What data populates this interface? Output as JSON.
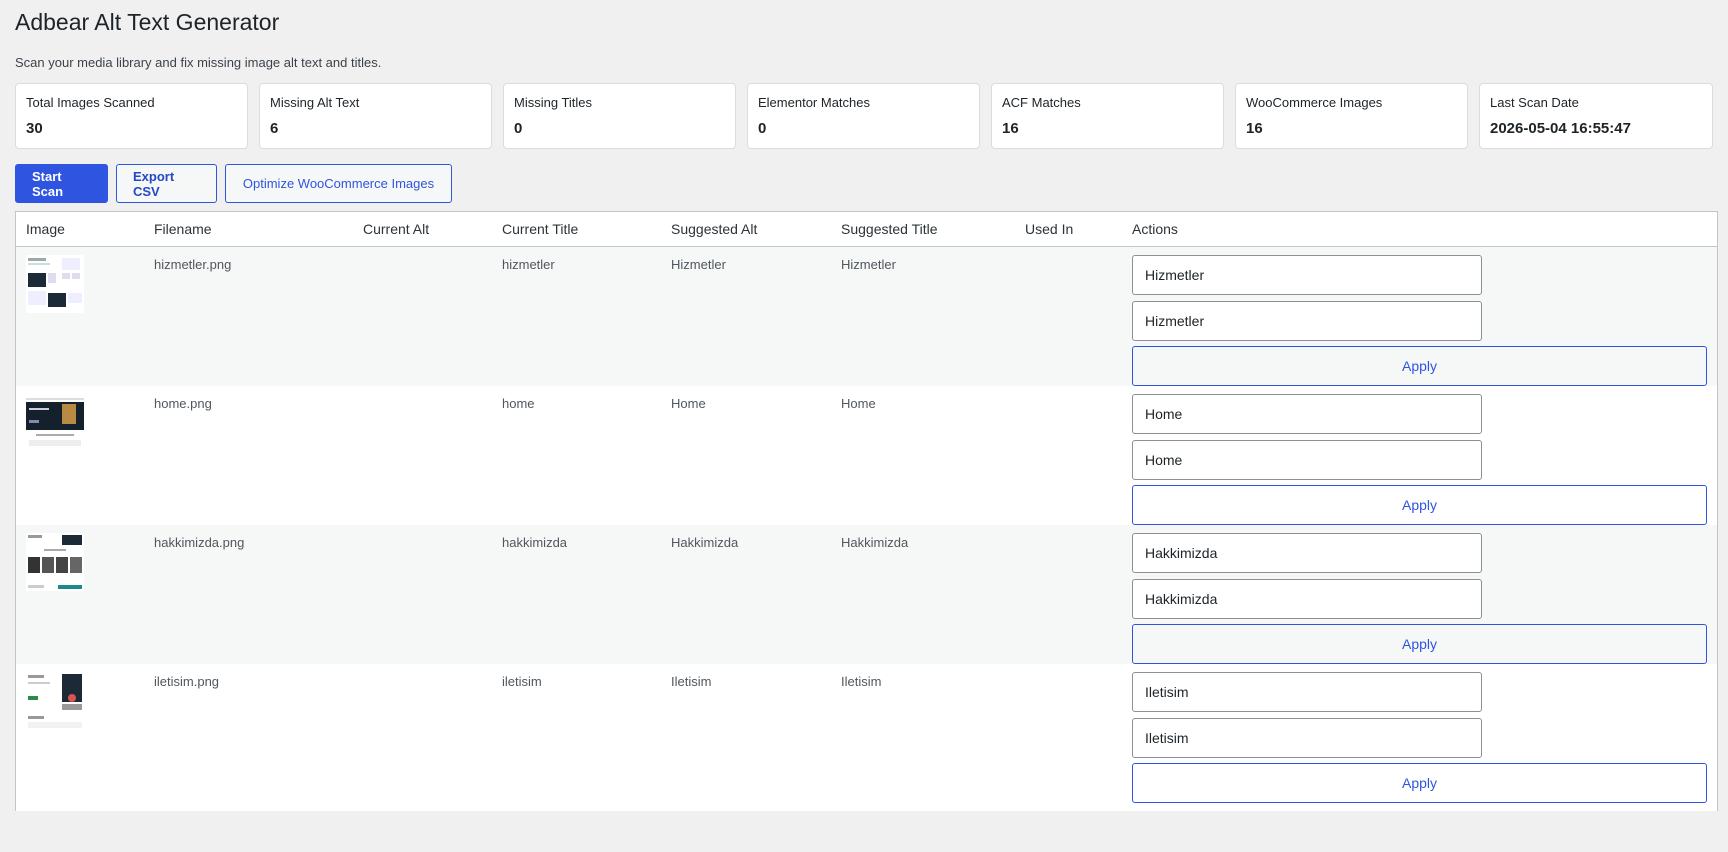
{
  "page": {
    "title": "Adbear Alt Text Generator",
    "subtitle": "Scan your media library and fix missing image alt text and titles."
  },
  "stats": [
    {
      "label": "Total Images Scanned",
      "value": "30"
    },
    {
      "label": "Missing Alt Text",
      "value": "6"
    },
    {
      "label": "Missing Titles",
      "value": "0"
    },
    {
      "label": "Elementor Matches",
      "value": "0"
    },
    {
      "label": "ACF Matches",
      "value": "16"
    },
    {
      "label": "WooCommerce Images",
      "value": "16"
    },
    {
      "label": "Last Scan Date",
      "value": "2026-05-04 16:55:47"
    }
  ],
  "toolbar": {
    "start_scan": "Start Scan",
    "export_csv": "Export CSV",
    "optimize_woo": "Optimize WooCommerce Images"
  },
  "table": {
    "headers": [
      "Image",
      "Filename",
      "Current Alt",
      "Current Title",
      "Suggested Alt",
      "Suggested Title",
      "Used In",
      "Actions"
    ],
    "apply_label": "Apply",
    "rows": [
      {
        "filename": "hizmetler.png",
        "current_alt": "",
        "current_title": "hizmetler",
        "suggested_alt": "Hizmetler",
        "suggested_title": "Hizmetler",
        "used_in": "",
        "alt_value": "Hizmetler",
        "title_value": "Hizmetler"
      },
      {
        "filename": "home.png",
        "current_alt": "",
        "current_title": "home",
        "suggested_alt": "Home",
        "suggested_title": "Home",
        "used_in": "",
        "alt_value": "Home",
        "title_value": "Home"
      },
      {
        "filename": "hakkimizda.png",
        "current_alt": "",
        "current_title": "hakkimizda",
        "suggested_alt": "Hakkimizda",
        "suggested_title": "Hakkimizda",
        "used_in": "",
        "alt_value": "Hakkimizda",
        "title_value": "Hakkimizda"
      },
      {
        "filename": "iletisim.png",
        "current_alt": "",
        "current_title": "iletisim",
        "suggested_alt": "Iletisim",
        "suggested_title": "Iletisim",
        "used_in": "",
        "alt_value": "Iletisim",
        "title_value": "Iletisim"
      }
    ]
  },
  "colors": {
    "accent": "#2f55e0",
    "background": "#f0f0f1",
    "row_alt": "#f6f7f7"
  }
}
